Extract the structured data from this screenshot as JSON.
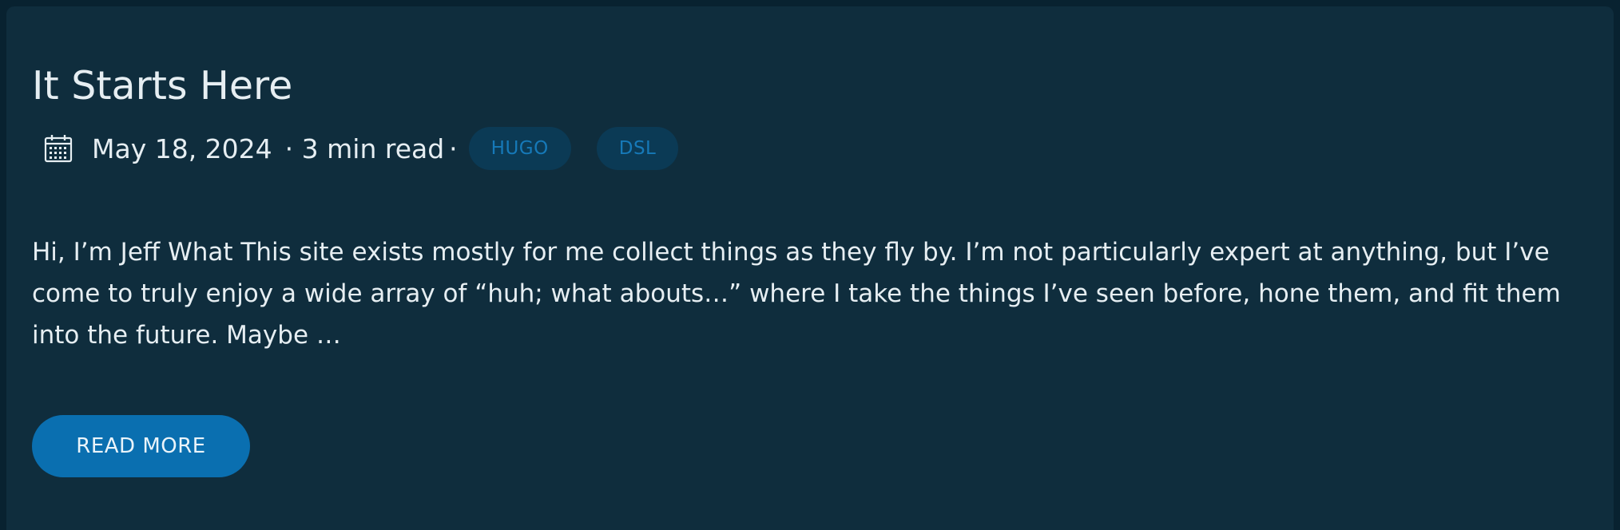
{
  "post": {
    "title": "It Starts Here",
    "date": "May 18, 2024",
    "read_time": "· 3 min read",
    "separator": "·",
    "tags": [
      "HUGO",
      "DSL"
    ],
    "summary": "Hi, I’m Jeff What This site exists mostly for me collect things as they fly by. I’m not particularly expert at anything, but I’ve come to truly enjoy a wide array of “huh; what abouts…” where I take the things I’ve seen before, hone them, and fit them into the future. Maybe …",
    "read_more_label": "READ MORE"
  },
  "icons": {
    "calendar": "calendar-icon"
  },
  "colors": {
    "page_background": "#082230",
    "card_background": "#0f2d3d",
    "text": "#e6eef2",
    "tag_background": "#0b3a55",
    "tag_text": "#1679b8",
    "button_background": "#0a6fb0"
  }
}
